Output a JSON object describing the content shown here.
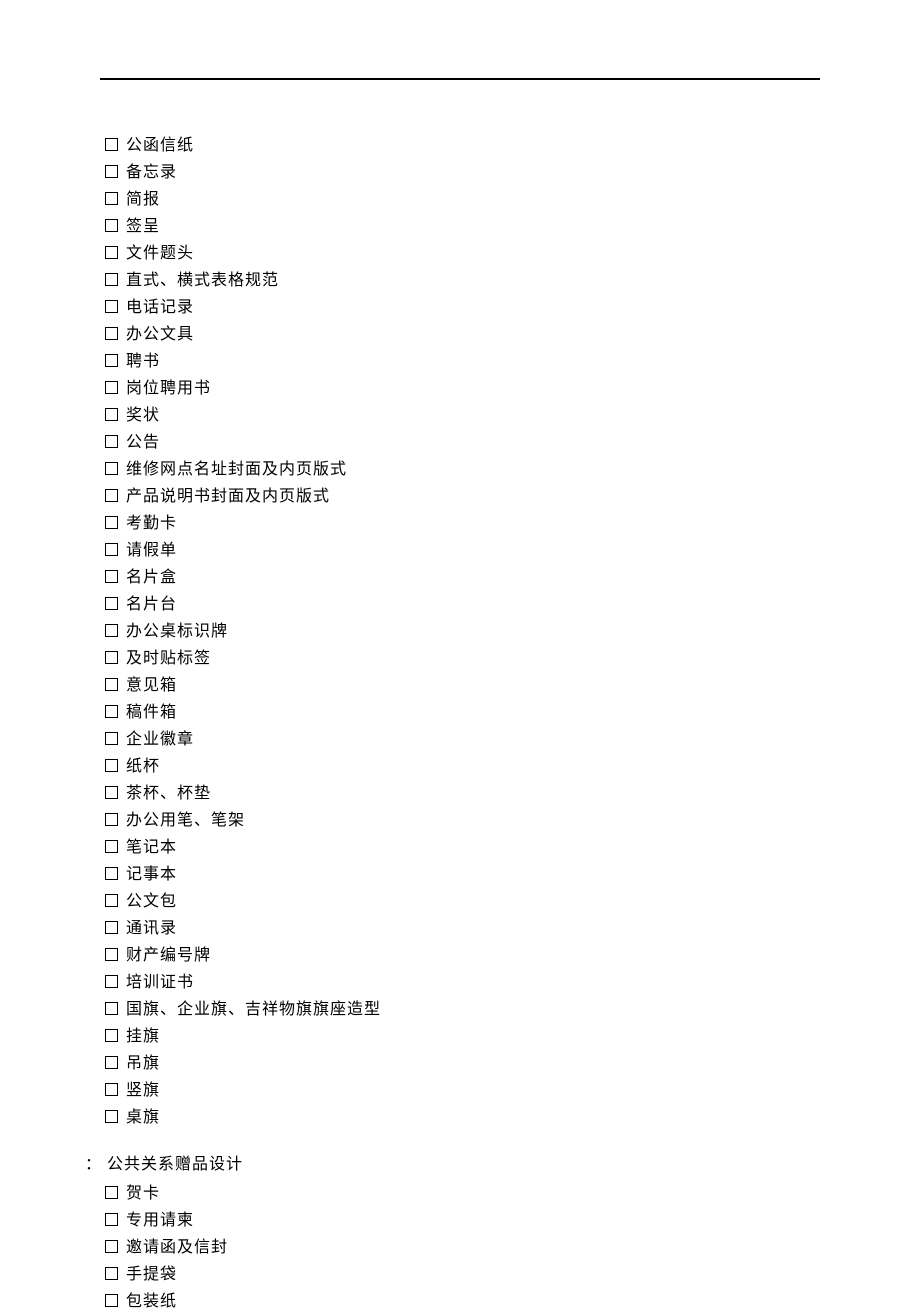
{
  "section1": {
    "items": [
      "公函信纸",
      "备忘录",
      "简报",
      "签呈",
      "文件题头",
      "直式、横式表格规范",
      "电话记录",
      "办公文具",
      "聘书",
      "岗位聘用书",
      "奖状",
      "公告",
      "维修网点名址封面及内页版式",
      "产品说明书封面及内页版式",
      "考勤卡",
      "请假单",
      "名片盒",
      "名片台",
      "办公桌标识牌",
      "及时贴标签",
      "意见箱",
      "稿件箱",
      "企业徽章",
      "纸杯",
      "茶杯、杯垫",
      "办公用笔、笔架",
      "笔记本",
      "记事本",
      "公文包",
      "通讯录",
      "财产编号牌",
      "培训证书",
      "国旗、企业旗、吉祥物旗旗座造型",
      "挂旗",
      "吊旗",
      "竖旗",
      "桌旗"
    ]
  },
  "section2": {
    "colon": "：",
    "title": "公共关系赠品设计",
    "items": [
      "贺卡",
      "专用请柬",
      "邀请函及信封",
      "手提袋",
      "包装纸"
    ]
  }
}
